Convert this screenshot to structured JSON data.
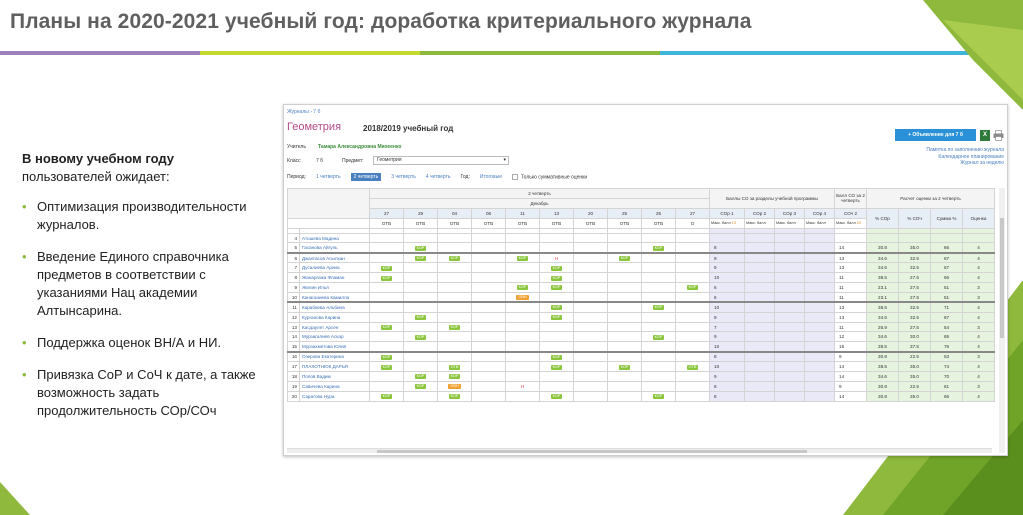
{
  "slide": {
    "title": "Планы на 2020-2021  учебный год: доработка критериального журнала",
    "colors": {
      "accent_green": "#8fb93c",
      "rule_purple": "#9b7fb8",
      "rule_lime": "#c4d82e",
      "rule_blue": "#3fb6d9",
      "rule_green": "#6bbf4a"
    }
  },
  "left": {
    "intro_bold": "В новому учебном году",
    "intro_rest": "пользователей ожидает:",
    "bullets": [
      "Оптимизация производительности журналов.",
      "Введение  Единого справочника предметов в соответствии с указаниями Нац академии Алтынсарина.",
      "Поддержка оценок ВН/А и НИ.",
      "Привязка СоР и СоЧ к дате, а также возможность задать продолжительность СОр/СОч"
    ]
  },
  "journal": {
    "breadcrumb": "Журналы › 7 б",
    "subject_title": "Геометрия",
    "year_title": "2018/2019 учебный год",
    "teacher_label": "Учитель",
    "teacher_value": "Тамара Александровна Михеенко",
    "class_label": "Класс",
    "class_value": "7 б",
    "subject_label": "Предмет:",
    "subject_value": "Геометрия",
    "period": {
      "label": "Период:",
      "q1": "1 четверть",
      "q2": "2 четверть",
      "q3": "3 четверть",
      "q4": "4 четверть",
      "year": "Год:",
      "final": "Итоговые",
      "summative_only": "Только суммативные оценки"
    },
    "add_button": "+ Объявление для 7 б",
    "excel_icon": "excel-icon",
    "print_icon": "printer-icon",
    "side_links": [
      "Памятка по заполнению журнала",
      "Календарное планирование",
      "Журнал за неделю"
    ],
    "headers": {
      "quarter": "2 четверть",
      "month": "Декабрь",
      "so_sections": "Баллы СО за разделы учебной программы",
      "soch_q": "Балл СО за 2 четверть",
      "calc": "Расчет оценки за 2 четверть"
    },
    "days": [
      "27",
      "29",
      "04",
      "06",
      "11",
      "13",
      "20",
      "25",
      "25",
      "27"
    ],
    "forms": [
      "ОТВ",
      "ОТВ",
      "ОТВ",
      "ОТВ",
      "ОТВ",
      "ОТВ",
      "ОТВ",
      "ОТВ",
      "ОТВ",
      "О"
    ],
    "so_cols": [
      "СОр 1",
      "СОр 2",
      "СОр 3",
      "СОр 4",
      "СОч 2"
    ],
    "calc_cols": [
      "% СОр",
      "% СОч",
      "Сумма %",
      "Оценка"
    ],
    "max_label": "Макс. балл",
    "max_so1": "13",
    "max_soch": "20",
    "cut_row": "...",
    "rows": [
      {
        "n": "4",
        "name": "Атошева Мадина",
        "marks": [
          "",
          "",
          "",
          "",
          "",
          "",
          "",
          "",
          "",
          ""
        ],
        "so1": "",
        "soch": "",
        "psor": "",
        "psoch": "",
        "sum": "",
        "grade": ""
      },
      {
        "n": "5",
        "name": "Гасанова Айгуль",
        "marks": [
          "",
          "КОР",
          "",
          "",
          "",
          "",
          "",
          "",
          "КОР",
          ""
        ],
        "so1": "8",
        "soch": "14",
        "psor": "30.8",
        "psoch": "35.0",
        "sum": "66",
        "grade": "4"
      },
      {
        "n": "6",
        "name": "Джалгасов Асылхан",
        "marks": [
          "",
          "КОР",
          "КОР",
          "",
          "КОР",
          "Н",
          "",
          "КОР",
          "",
          ""
        ],
        "so1": "9",
        "soch": "13",
        "psor": "34.6",
        "psoch": "32.5",
        "sum": "67",
        "grade": "4",
        "sep": true
      },
      {
        "n": "7",
        "name": "Дусалиева Арина",
        "marks": [
          "КОР",
          "",
          "",
          "",
          "",
          "КОР",
          "",
          "",
          "",
          ""
        ],
        "so1": "9",
        "soch": "13",
        "psor": "34.6",
        "psoch": "32.5",
        "sum": "67",
        "grade": "4"
      },
      {
        "n": "8",
        "name": "Жанаргажа Фламан",
        "marks": [
          "КОР",
          "",
          "",
          "",
          "",
          "КОР",
          "",
          "",
          "",
          ""
        ],
        "so1": "10",
        "soch": "11",
        "psor": "38.5",
        "psoch": "27.5",
        "sum": "66",
        "grade": "4"
      },
      {
        "n": "9",
        "name": "Жилин Илья",
        "marks": [
          "",
          "",
          "",
          "",
          "КОР",
          "КОР",
          "",
          "",
          "",
          "КОР"
        ],
        "so1": "6",
        "soch": "11",
        "psor": "23.1",
        "psoch": "27.5",
        "sum": "51",
        "grade": "3"
      },
      {
        "n": "10",
        "name": "Канаганиева Камилла",
        "marks": [
          "",
          "",
          "",
          "",
          "ОВН",
          "",
          "",
          "",
          "",
          ""
        ],
        "so1": "6",
        "soch": "11",
        "psor": "23.1",
        "psoch": "27.5",
        "sum": "51",
        "grade": "3"
      },
      {
        "n": "11",
        "name": "Карабаева Альбина",
        "marks": [
          "",
          "",
          "",
          "",
          "",
          "КОР",
          "",
          "",
          "КОР",
          ""
        ],
        "so1": "10",
        "soch": "13",
        "psor": "38.5",
        "psoch": "32.5",
        "sum": "71",
        "grade": "4",
        "sep": true
      },
      {
        "n": "12",
        "name": "Курганова Карина",
        "marks": [
          "",
          "КОР",
          "",
          "",
          "",
          "КОР",
          "",
          "",
          "",
          ""
        ],
        "so1": "9",
        "soch": "13",
        "psor": "34.6",
        "psoch": "32.5",
        "sum": "67",
        "grade": "4"
      },
      {
        "n": "13",
        "name": "Касдаулет Арсен",
        "marks": [
          "КОР",
          "",
          "КОР",
          "",
          "",
          "",
          "",
          "",
          "",
          ""
        ],
        "so1": "7",
        "soch": "11",
        "psor": "26.9",
        "psoch": "27.5",
        "sum": "54",
        "grade": "3"
      },
      {
        "n": "14",
        "name": "Мурзагалиев Аскар",
        "marks": [
          "",
          "КОР",
          "",
          "",
          "",
          "",
          "",
          "",
          "КОР",
          ""
        ],
        "so1": "9",
        "soch": "12",
        "psor": "34.6",
        "psoch": "30.0",
        "sum": "65",
        "grade": "4"
      },
      {
        "n": "15",
        "name": "Мурзахметова Юлия",
        "marks": [
          "",
          "",
          "",
          "",
          "",
          "",
          "",
          "",
          "",
          ""
        ],
        "so1": "10",
        "soch": "15",
        "psor": "38.5",
        "psoch": "37.5",
        "sum": "76",
        "grade": "4"
      },
      {
        "n": "16",
        "name": "Озерова Екатерина",
        "marks": [
          "КОР",
          "",
          "",
          "",
          "",
          "КОР",
          "",
          "",
          "",
          ""
        ],
        "so1": "8",
        "soch": "9",
        "psor": "30.8",
        "psoch": "22.5",
        "sum": "53",
        "grade": "3",
        "sep": true
      },
      {
        "n": "17",
        "name": "ПЛАХОТНЮК ДАРЬЯ",
        "marks": [
          "КОР",
          "",
          "ОТВ",
          "",
          "",
          "КОР",
          "",
          "КОР",
          "",
          "ОТВ"
        ],
        "so1": "10",
        "soch": "14",
        "psor": "38.5",
        "psoch": "35.0",
        "sum": "74",
        "grade": "4"
      },
      {
        "n": "18",
        "name": "Попов Вадим",
        "marks": [
          "",
          "КОР",
          "КОР",
          "",
          "",
          "",
          "",
          "",
          "",
          ""
        ],
        "so1": "9",
        "soch": "14",
        "psor": "34.6",
        "psoch": "35.0",
        "sum": "70",
        "grade": "4"
      },
      {
        "n": "19",
        "name": "Савичева Карина",
        "marks": [
          "",
          "КОР",
          "ОВН",
          "",
          "Н",
          "",
          "",
          "",
          "",
          ""
        ],
        "so1": "8",
        "soch": "9",
        "psor": "30.8",
        "psoch": "22.5",
        "sum": "61",
        "grade": "3"
      },
      {
        "n": "20",
        "name": "Саратова Нура",
        "marks": [
          "КОР",
          "",
          "КОР",
          "",
          "",
          "КОР",
          "",
          "",
          "КОР",
          ""
        ],
        "so1": "8",
        "soch": "14",
        "psor": "30.8",
        "psoch": "35.0",
        "sum": "66",
        "grade": "4"
      }
    ]
  }
}
